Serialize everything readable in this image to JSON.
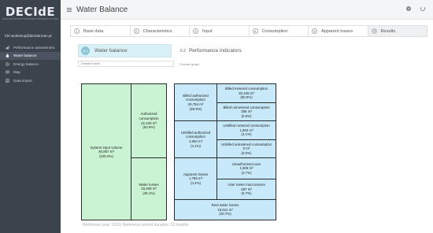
{
  "app": {
    "logo": "DECIdE",
    "logo_sub": "DECISION SUPPORT PLATFORM FOR WATER UTILITIES",
    "user": "Clé workshop@decide.lnec.pt"
  },
  "sidebar": {
    "items": [
      {
        "label": "Performance assessment",
        "icon": "bar-chart-icon",
        "active": false
      },
      {
        "label": "Water balance",
        "icon": "droplet-icon",
        "active": true
      },
      {
        "label": "Energy balance",
        "icon": "bolt-icon",
        "active": false
      },
      {
        "label": "Map",
        "icon": "map-icon",
        "active": false
      },
      {
        "label": "Data import",
        "icon": "table-icon",
        "active": false
      }
    ]
  },
  "header": {
    "title": "Water Balance",
    "help_icon": "?",
    "power_icon": "power-icon"
  },
  "steps": [
    {
      "num": "1",
      "label": "Base data"
    },
    {
      "num": "2",
      "label": "Characteristics"
    },
    {
      "num": "3",
      "label": "Input"
    },
    {
      "num": "4",
      "label": "Consumption"
    },
    {
      "num": "5",
      "label": "Apparent losses"
    },
    {
      "num": "6",
      "label": "Results"
    }
  ],
  "subtabs": [
    {
      "num": "6.1",
      "label": "Water balance"
    },
    {
      "num": "6.2",
      "label": "Performance indicators"
    }
  ],
  "controls": {
    "table_select": "Detailed table",
    "graph_label": "Choose graph"
  },
  "water_balance": {
    "system_input": {
      "title": "System input volume",
      "value": "40,857 m³",
      "pct": "(100.0%)"
    },
    "authorized": {
      "title": "Authorized consumption",
      "value": "22,449 m³",
      "pct": "(54.9%)"
    },
    "water_losses": {
      "title": "Water losses",
      "value": "18,408 m³",
      "pct": "(45.1%)"
    },
    "billed_authorized": {
      "title": "Billed authorized consumption",
      "value": "20,784 m³",
      "pct": "(50.9%)"
    },
    "unbilled_authorized": {
      "title": "Unbilled authorized consumption",
      "value": "1,664 m³",
      "pct": "(4.1%)"
    },
    "apparent_losses": {
      "title": "Apparent losses",
      "value": "1,796 m³",
      "pct": "(4.4%)"
    },
    "billed_metered": {
      "title": "Billed metered consumption",
      "value": "20,428 m³",
      "pct": "(50.0%)"
    },
    "billed_unmetered": {
      "title": "Billed unmetered consumption",
      "value": "356 m³",
      "pct": "(0.9%)"
    },
    "unbilled_metered": {
      "title": "Unbilled metered consumption",
      "value": "1,664 m³",
      "pct": "(4.1%)"
    },
    "unbilled_unmetered": {
      "title": "Unbilled unmetered consumption",
      "value": "0 m³",
      "pct": "(0.0%)"
    },
    "unauthorized": {
      "title": "Unauthorized uses",
      "value": "1,509 m³",
      "pct": "(3.7%)"
    },
    "meter_inaccuracies": {
      "title": "User meter inaccuracies",
      "value": "287 m³",
      "pct": "(0.7%)"
    },
    "real_losses": {
      "title": "Real water losses",
      "value": "16,611 m³",
      "pct": "(40.7%)"
    }
  },
  "footnote": "Reference year: 2019; Reference period duration: 12 months",
  "colors": {
    "green": "#c9f3d2",
    "blue": "#c8e9f9",
    "sidebar": "#3b434d"
  }
}
